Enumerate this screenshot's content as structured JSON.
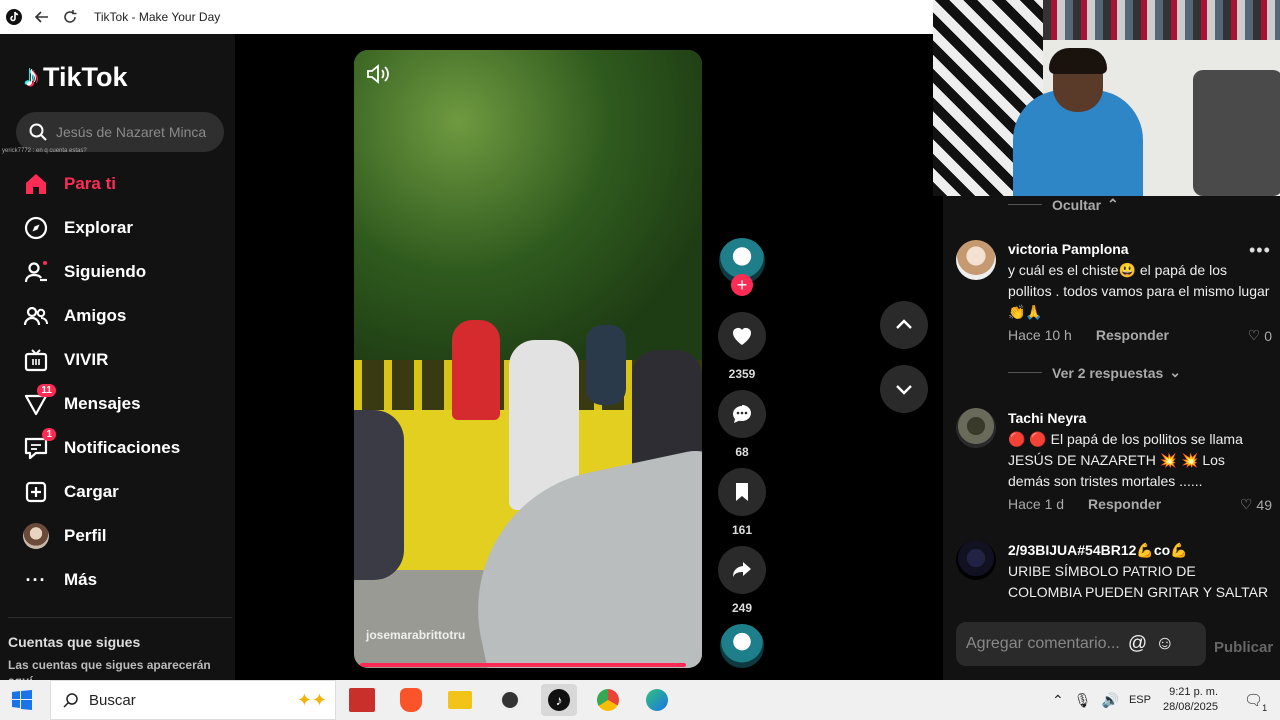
{
  "window": {
    "title": "TikTok - Make Your Day"
  },
  "sidebar": {
    "logo_text": "TikTok",
    "search_placeholder": "Jesús de Nazaret Minca",
    "chat_overlay": "yerick7772 : en q cuenta estas?",
    "nav": [
      {
        "label": "Para ti",
        "icon": "home-icon",
        "active": true
      },
      {
        "label": "Explorar",
        "icon": "compass-icon"
      },
      {
        "label": "Siguiendo",
        "icon": "following-icon"
      },
      {
        "label": "Amigos",
        "icon": "friends-icon"
      },
      {
        "label": "VIVIR",
        "icon": "live-icon"
      },
      {
        "label": "Mensajes",
        "icon": "messages-icon",
        "badge": "11"
      },
      {
        "label": "Notificaciones",
        "icon": "notifications-icon",
        "badge": "1"
      },
      {
        "label": "Cargar",
        "icon": "upload-icon"
      },
      {
        "label": "Perfil",
        "icon": "profile-avatar"
      },
      {
        "label": "Más",
        "icon": "more-icon"
      }
    ],
    "following_title": "Cuentas que sigues",
    "following_sub": "Las cuentas que sigues aparecerán aquí"
  },
  "video": {
    "handle": "josemarabrittotru",
    "likes": "2359",
    "comments": "68",
    "saves": "161",
    "shares": "249"
  },
  "comments_panel": {
    "hide_label": "Ocultar",
    "comments": [
      {
        "author": "victoria Pamplona",
        "text": "y cuál es el chiste😃 el papá de los pollitos . todos vamos para el mismo lugar 👏🙏",
        "time": "Hace 10 h",
        "reply": "Responder",
        "likes": "0"
      },
      {
        "author": "Tachi Neyra",
        "text": "🔴 🔴 El papá de los pollitos se llama JESÚS DE NAZARETH 💥 💥 Los demás son tristes mortales ......",
        "time": "Hace 1 d",
        "reply": "Responder",
        "likes": "49"
      },
      {
        "author": "2/93BIJUA#54BR12💪co💪",
        "text": "URIBE SÍMBOLO PATRIO DE COLOMBIA PUEDEN GRITAR Y SALTAR Y SIGUE"
      }
    ],
    "view_replies": "Ver 2 respuestas",
    "input_placeholder": "Agregar comentario...",
    "publish_label": "Publicar"
  },
  "taskbar": {
    "search_label": "Buscar",
    "lang": "ESP",
    "time": "9:21 p. m.",
    "date": "28/08/2025",
    "notification_count": "1"
  },
  "colors": {
    "accent": "#fe2c55",
    "background": "#000000",
    "panel": "#121212"
  }
}
